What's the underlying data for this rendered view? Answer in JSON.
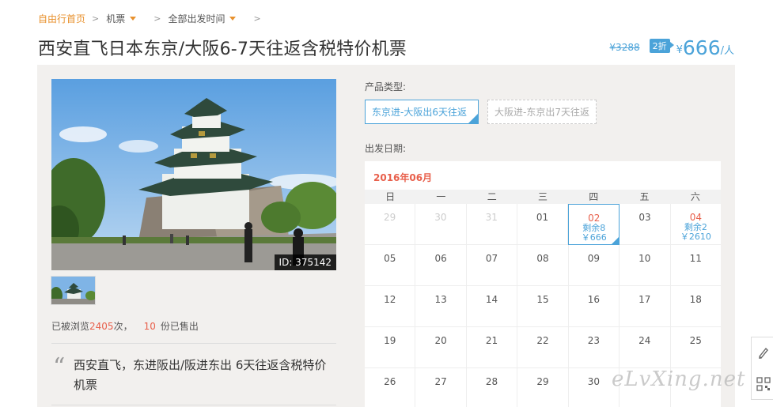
{
  "breadcrumb": {
    "home": "自由行首页",
    "category": "机票",
    "departure": "全部出发时间"
  },
  "product": {
    "title": "西安直飞日本东京/大阪6-7天往返含税特价机票",
    "original_price": "¥3288",
    "discount": "2折",
    "currency": "¥",
    "price": "666",
    "unit": "/人"
  },
  "gallery": {
    "image_id": "ID: 375142"
  },
  "stats": {
    "prefix": "已被浏览",
    "views": "2405",
    "mid": "次，",
    "sold": "10",
    "suffix": "份已售出"
  },
  "description": "西安直飞，东进阪出/阪进东出 6天往返含税特价机票",
  "product_type": {
    "label": "产品类型:",
    "options": [
      "东京进-大阪出6天往返",
      "大阪进-东京出7天往返"
    ]
  },
  "departure": {
    "label": "出发日期:",
    "month": "2016年06月",
    "weekdays": [
      "日",
      "一",
      "二",
      "三",
      "四",
      "五",
      "六"
    ],
    "weeks": [
      [
        {
          "d": "29",
          "muted": true
        },
        {
          "d": "30",
          "muted": true
        },
        {
          "d": "31",
          "muted": true
        },
        {
          "d": "01"
        },
        {
          "d": "02",
          "avail": true,
          "selected": true,
          "stock": "剩余8",
          "price": "￥666"
        },
        {
          "d": "03"
        },
        {
          "d": "04",
          "avail": true,
          "stock": "剩余2",
          "price": "￥2610"
        }
      ],
      [
        {
          "d": "05"
        },
        {
          "d": "06"
        },
        {
          "d": "07"
        },
        {
          "d": "08"
        },
        {
          "d": "09"
        },
        {
          "d": "10"
        },
        {
          "d": "11"
        }
      ],
      [
        {
          "d": "12"
        },
        {
          "d": "13"
        },
        {
          "d": "14"
        },
        {
          "d": "15"
        },
        {
          "d": "16"
        },
        {
          "d": "17"
        },
        {
          "d": "18"
        }
      ],
      [
        {
          "d": "19"
        },
        {
          "d": "20"
        },
        {
          "d": "21"
        },
        {
          "d": "22"
        },
        {
          "d": "23"
        },
        {
          "d": "24"
        },
        {
          "d": "25"
        }
      ],
      [
        {
          "d": "26"
        },
        {
          "d": "27"
        },
        {
          "d": "28"
        },
        {
          "d": "29"
        },
        {
          "d": "30"
        },
        {
          "d": ""
        },
        {
          "d": ""
        }
      ]
    ]
  },
  "watermark": "eLvXing.net",
  "icons": {
    "side_top": "pen-icon",
    "side_bottom": "qrcode-icon"
  },
  "colors": {
    "accent": "#4ba3d9",
    "orange": "#e8912d",
    "highlight": "#e8604c"
  }
}
